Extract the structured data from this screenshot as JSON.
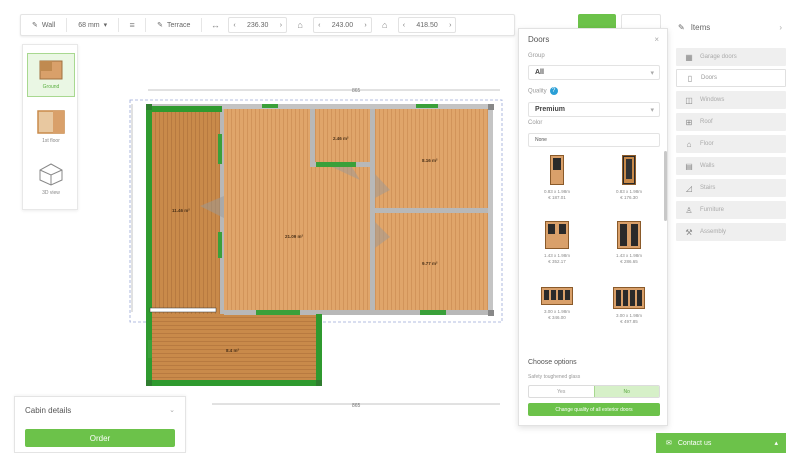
{
  "toolbar": {
    "wall_label": "Wall",
    "thickness_value": "68 mm",
    "terrace_label": "Terrace",
    "stepper1_value": "236.30",
    "stepper2_value": "243.00",
    "stepper3_value": "418.50"
  },
  "views": [
    {
      "label": "Ground"
    },
    {
      "label": "1st floor"
    },
    {
      "label": "3D view"
    }
  ],
  "plan": {
    "rooms": [
      {
        "area": "11.46 m²"
      },
      {
        "area": "2.46 m²"
      },
      {
        "area": "8.16 m²"
      },
      {
        "area": "21.09 m²"
      },
      {
        "area": "9.77 m²"
      },
      {
        "area": "8.4 m²"
      }
    ],
    "top_dim": "865",
    "bottom_dim": "865"
  },
  "items": {
    "title": "Items",
    "list": [
      {
        "label": "Garage doors",
        "icon": "garage-door-icon"
      },
      {
        "label": "Doors",
        "icon": "door-icon"
      },
      {
        "label": "Windows",
        "icon": "window-icon"
      },
      {
        "label": "Roof",
        "icon": "roof-icon"
      },
      {
        "label": "Floor",
        "icon": "floor-icon"
      },
      {
        "label": "Walls",
        "icon": "wall-icon"
      },
      {
        "label": "Stairs",
        "icon": "stairs-icon"
      },
      {
        "label": "Furniture",
        "icon": "chair-icon"
      },
      {
        "label": "Assembly",
        "icon": "wrench-icon"
      }
    ]
  },
  "doors": {
    "title": "Doors",
    "group_label": "Group",
    "group_value": "All",
    "quality_label": "Quality",
    "quality_value": "Premium",
    "color_label": "Color",
    "color_value": "None",
    "products": [
      {
        "size": "0.83 x 1.98m",
        "price": "€ 187.01"
      },
      {
        "size": "0.83 x 1.98m",
        "price": "€ 176.30"
      },
      {
        "size": "1.43 x 1.98m",
        "price": "€ 352.17"
      },
      {
        "size": "1.43 x 1.98m",
        "price": "€ 286.65"
      },
      {
        "size": "3.00 x 1.98m",
        "price": "€ 346.00"
      },
      {
        "size": "3.00 x 1.98m",
        "price": "€ 497.85"
      }
    ],
    "choose_options_title": "Choose options",
    "safety_label": "Safety toughened glass",
    "toggle_yes": "Yes",
    "toggle_no": "No",
    "change_button": "Change quality of all exterior doors"
  },
  "cabin": {
    "title": "Cabin details",
    "order_button": "Order"
  },
  "contact": {
    "label": "Contact us"
  },
  "colors": {
    "accent": "#6cc24a",
    "wall": "#2f9a2f",
    "floor": "#e0a56a",
    "floor_dark": "#c98a4a",
    "info": "#2a9fd6"
  }
}
